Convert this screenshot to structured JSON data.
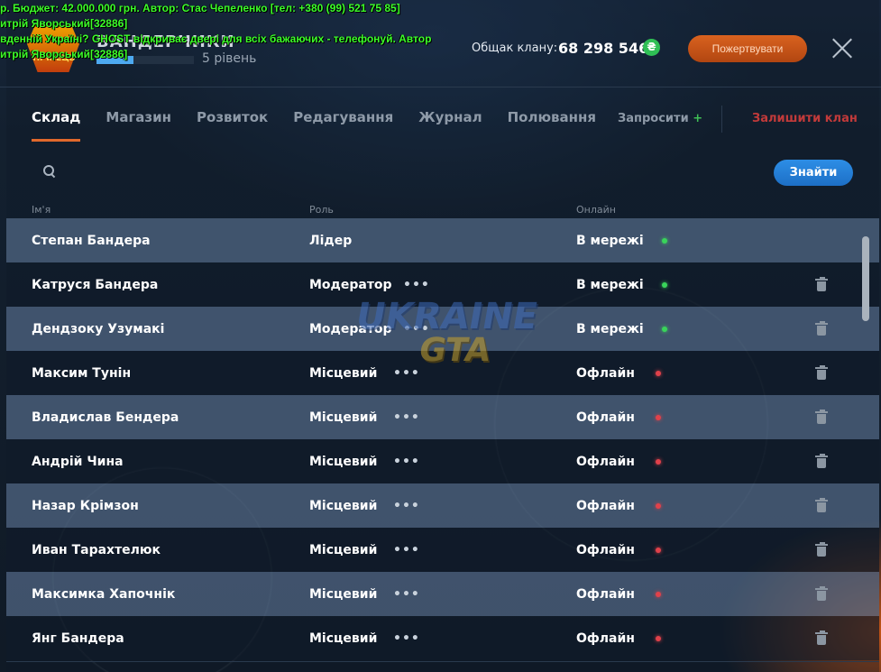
{
  "chat": {
    "line1": "р. Бюджет: 42.000.000 грн. Автор: Стас Чепеленко [тел: +380 (99) 521 75 85]",
    "line2": "итрій Яворський[32886]",
    "line3": "вденній Україні? GHOST відкриває двері для всіх бажаючих - телефонуй. Автор",
    "line4": "итрій Яворський[32886]"
  },
  "header": {
    "clan_name": "БАНДЕРЧИКИ",
    "logo_text": "ПІЧНЕЦЬ",
    "level": "5 рівень",
    "xp_fraction": 0.38,
    "money_label": "Общак клану:",
    "money_value": "68 298 546",
    "currency_icon": "₴",
    "donate_label": "Пожертвувати"
  },
  "tabs": [
    "Склад",
    "Магазин",
    "Розвиток",
    "Редагування",
    "Журнал",
    "Полювання"
  ],
  "actions": {
    "invite": "Запросити",
    "invite_plus": "+",
    "leave": "Залишити клан"
  },
  "search": {
    "placeholder": "",
    "button": "Знайти"
  },
  "columns": {
    "name": "Ім'я",
    "role": "Роль",
    "online": "Онлайн"
  },
  "watermark": {
    "line1": "UKRAINE",
    "line2": "GTA"
  },
  "members": [
    {
      "name": "Степан Бандера",
      "role": "Лідер",
      "status": "В мережі",
      "online": true,
      "more": false,
      "trash": false
    },
    {
      "name": "Катруся Бандера",
      "role": "Модератор",
      "status": "В мережі",
      "online": true,
      "more": true,
      "trash": true
    },
    {
      "name": "Дендзоку Узумакі",
      "role": "Модератор",
      "status": "В мережі",
      "online": true,
      "more": true,
      "trash": true
    },
    {
      "name": "Максим Тунін",
      "role": "Місцевий",
      "status": "Офлайн",
      "online": false,
      "more": true,
      "trash": true
    },
    {
      "name": "Владислав Бендера",
      "role": "Місцевий",
      "status": "Офлайн",
      "online": false,
      "more": true,
      "trash": true
    },
    {
      "name": "Андрій Чина",
      "role": "Місцевий",
      "status": "Офлайн",
      "online": false,
      "more": true,
      "trash": true
    },
    {
      "name": "Назар Крімзон",
      "role": "Місцевий",
      "status": "Офлайн",
      "online": false,
      "more": true,
      "trash": true
    },
    {
      "name": "Иван Тарахтелюк",
      "role": "Місцевий",
      "status": "Офлайн",
      "online": false,
      "more": true,
      "trash": true
    },
    {
      "name": "Максимка Хапочнік",
      "role": "Місцевий",
      "status": "Офлайн",
      "online": false,
      "more": true,
      "trash": true
    },
    {
      "name": "Янг Бандера",
      "role": "Місцевий",
      "status": "Офлайн",
      "online": false,
      "more": true,
      "trash": true
    }
  ]
}
